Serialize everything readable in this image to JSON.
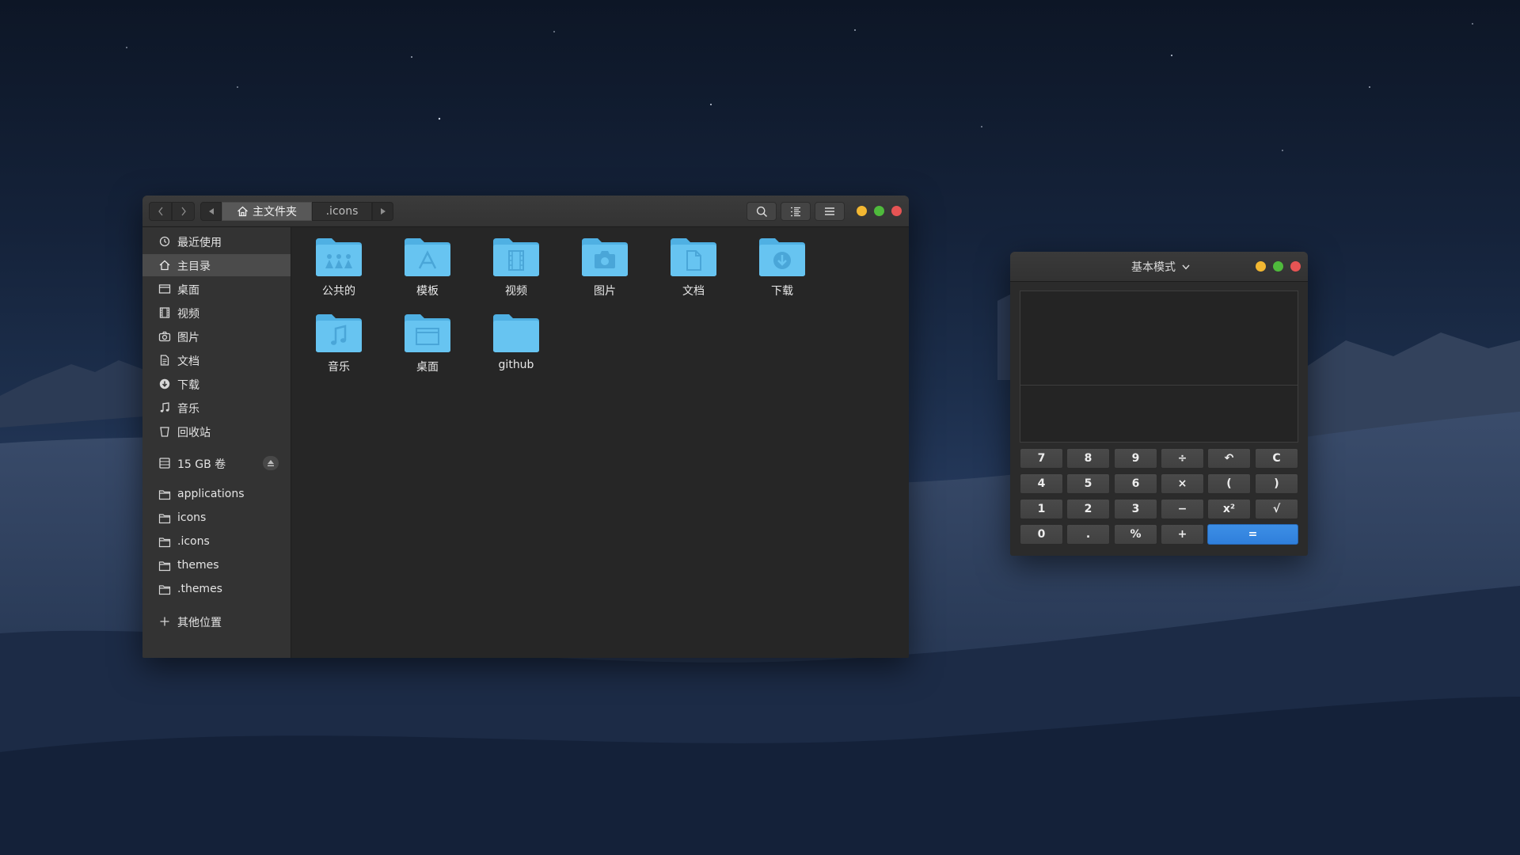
{
  "file_manager": {
    "breadcrumb": {
      "home": "主文件夹",
      "current": ".icons"
    },
    "toolbar": {
      "search_icon": "search-icon",
      "view_icon": "view-list-icon",
      "menu_icon": "menu-icon"
    },
    "sidebar": {
      "places": [
        {
          "label": "最近使用",
          "icon": "recent-icon"
        },
        {
          "label": "主目录",
          "icon": "home-icon",
          "active": true
        },
        {
          "label": "桌面",
          "icon": "desktop-icon"
        },
        {
          "label": "视频",
          "icon": "video-icon"
        },
        {
          "label": "图片",
          "icon": "camera-icon"
        },
        {
          "label": "文档",
          "icon": "document-icon"
        },
        {
          "label": "下载",
          "icon": "download-icon"
        },
        {
          "label": "音乐",
          "icon": "music-icon"
        },
        {
          "label": "回收站",
          "icon": "trash-icon"
        }
      ],
      "volume": {
        "label": "15 GB 卷",
        "icon": "drive-icon"
      },
      "bookmarks": [
        {
          "label": "applications"
        },
        {
          "label": "icons"
        },
        {
          "label": ".icons"
        },
        {
          "label": "themes"
        },
        {
          "label": ".themes"
        }
      ],
      "other": {
        "label": "其他位置"
      }
    },
    "folders": [
      {
        "label": "公共的",
        "emblem": "people"
      },
      {
        "label": "模板",
        "emblem": "template"
      },
      {
        "label": "视频",
        "emblem": "film"
      },
      {
        "label": "图片",
        "emblem": "camera"
      },
      {
        "label": "文档",
        "emblem": "doc"
      },
      {
        "label": "下载",
        "emblem": "download"
      },
      {
        "label": "音乐",
        "emblem": "music"
      },
      {
        "label": "桌面",
        "emblem": "desktop"
      },
      {
        "label": "github",
        "emblem": "none"
      }
    ]
  },
  "calculator": {
    "mode_label": "基本模式",
    "buttons": [
      [
        "7",
        "8",
        "9",
        "÷",
        "↶",
        "C"
      ],
      [
        "4",
        "5",
        "6",
        "×",
        "(",
        ")"
      ],
      [
        "1",
        "2",
        "3",
        "−",
        "x²",
        "√"
      ],
      [
        "0",
        ".",
        "%",
        "+",
        "="
      ]
    ]
  },
  "colors": {
    "folder_blue": "#62c1ef",
    "accent_blue": "#3487e0",
    "close_red": "#e65454",
    "minimize_yellow": "#f2b732",
    "maximize_green": "#4fba3c"
  }
}
